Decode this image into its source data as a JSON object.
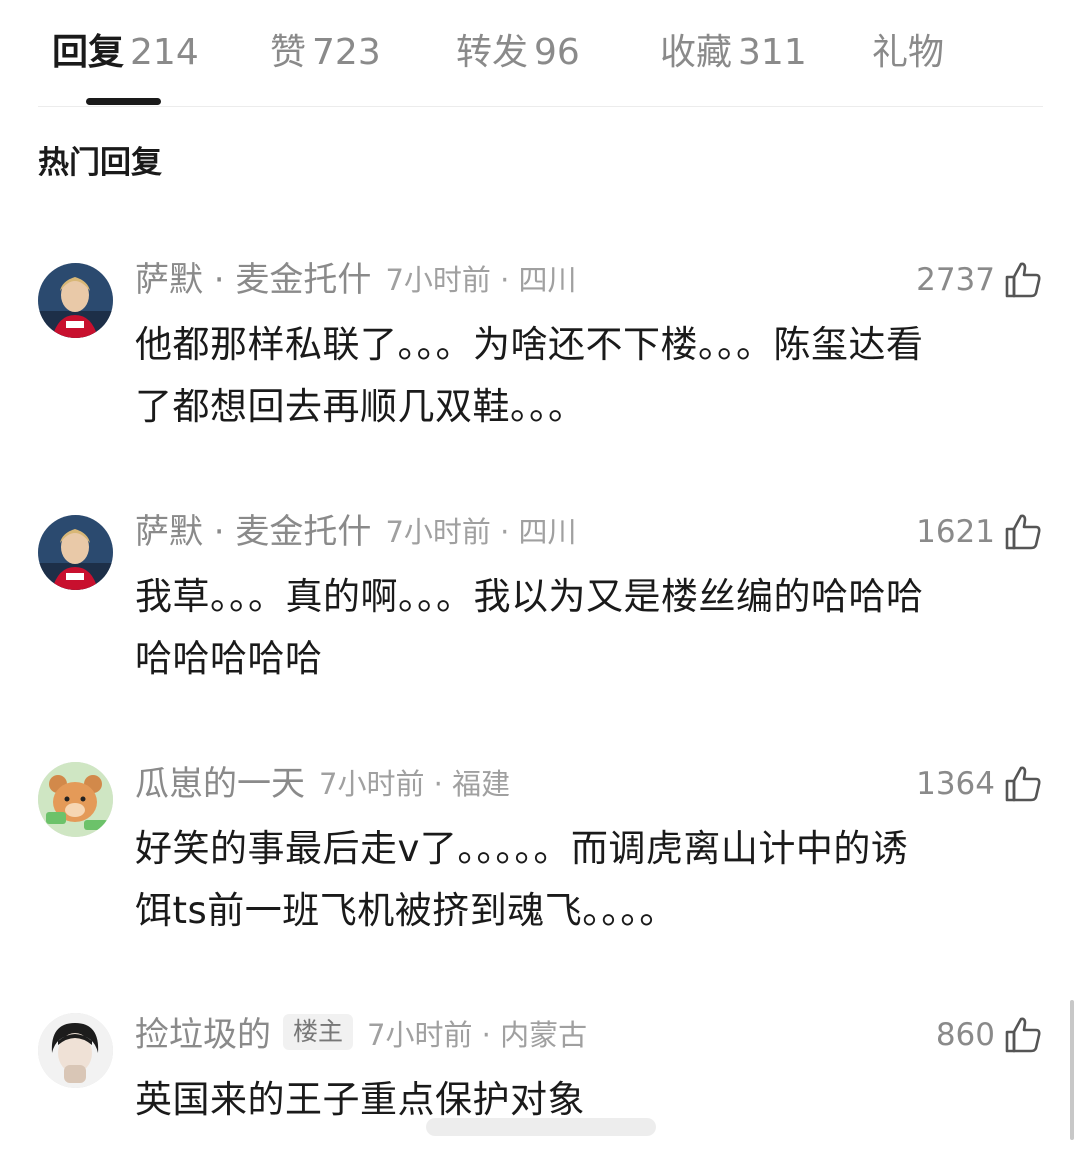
{
  "tabs": [
    {
      "label": "回复",
      "count": "214",
      "active": true
    },
    {
      "label": "赞",
      "count": "723",
      "active": false
    },
    {
      "label": "转发",
      "count": "96",
      "active": false
    },
    {
      "label": "收藏",
      "count": "311",
      "active": false
    },
    {
      "label": "礼物",
      "count": "",
      "active": false
    }
  ],
  "section_title": "热门回复",
  "comments": [
    {
      "name": "萨默 · 麦金托什",
      "badge": "",
      "time": "7小时前 · 四川",
      "likes": "2737",
      "lines": [
        "他都那样私联了。。。为啥还不下楼。。。陈玺达看",
        "了都想回去再顺几双鞋。。。"
      ],
      "avatar_icon": "swimmer-avatar"
    },
    {
      "name": "萨默 · 麦金托什",
      "badge": "",
      "time": "7小时前 · 四川",
      "likes": "1621",
      "lines": [
        "我草。。。真的啊。。。我以为又是楼丝编的哈哈哈",
        "哈哈哈哈哈"
      ],
      "avatar_icon": "swimmer-avatar"
    },
    {
      "name": "瓜崽的一天",
      "badge": "",
      "time": "7小时前 · 福建",
      "likes": "1364",
      "lines": [
        "好笑的事最后走v了。。。。。而调虎离山计中的诱",
        "饵ts前一班飞机被挤到魂飞。。。。"
      ],
      "avatar_icon": "cartoon-bear-avatar"
    },
    {
      "name": "捡垃圾的",
      "badge": "楼主",
      "time": "7小时前 · 内蒙古",
      "likes": "860",
      "lines": [
        "英国来的王子重点保护对象"
      ],
      "avatar_icon": "portrait-avatar"
    }
  ],
  "colors": {
    "text": "#1a1a1a",
    "muted": "#8a8a8a",
    "light": "#a0a0a0",
    "divider": "#ececec"
  }
}
